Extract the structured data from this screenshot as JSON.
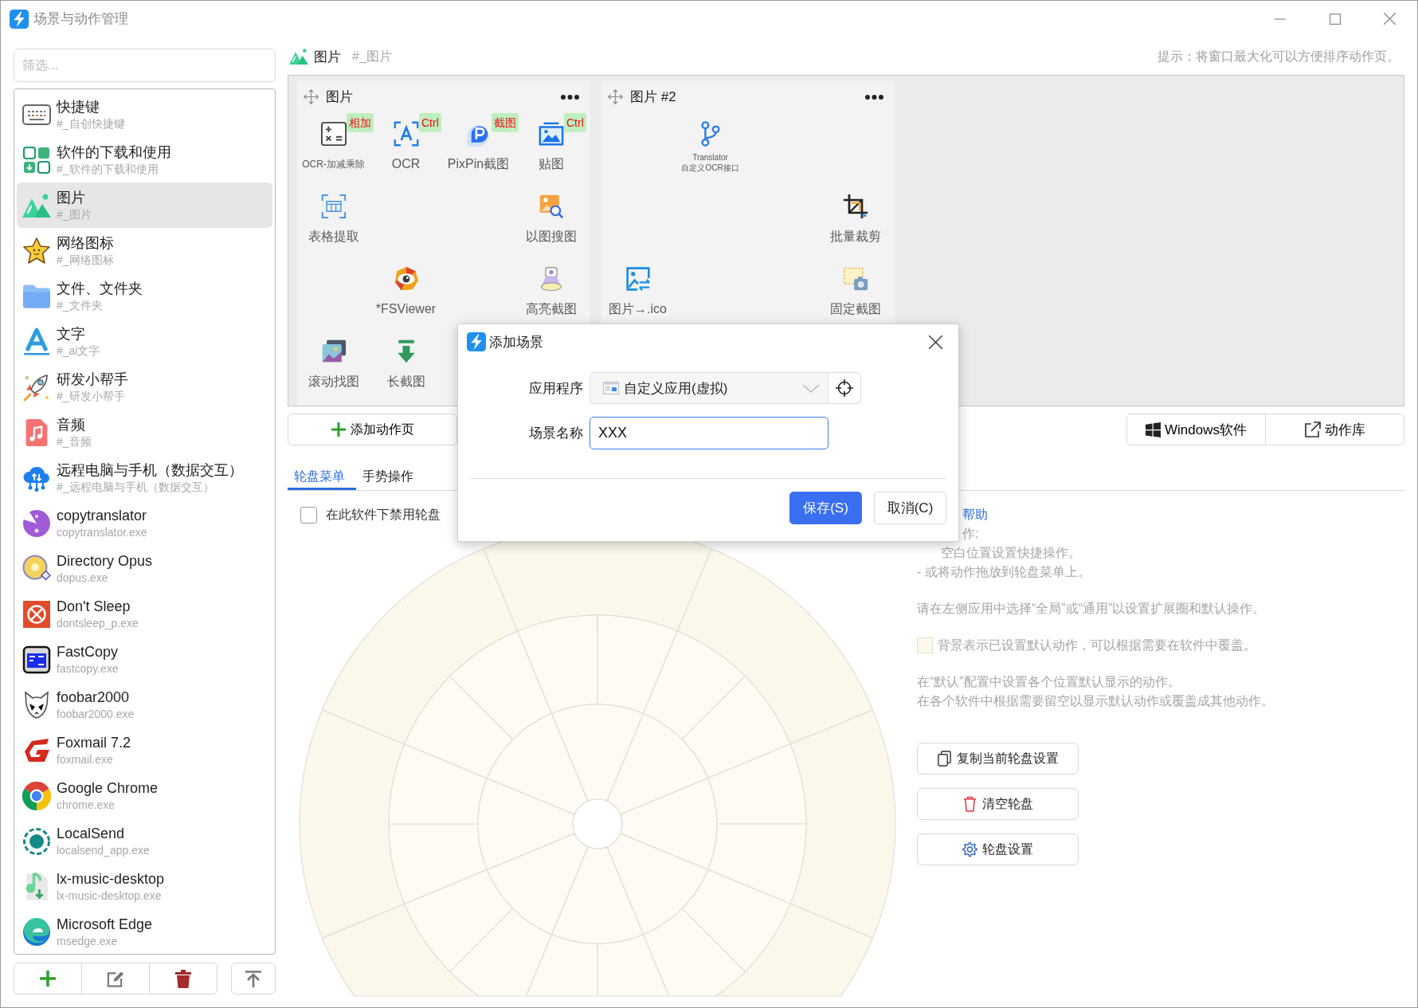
{
  "window": {
    "title": "场景与动作管理"
  },
  "sidebar": {
    "filter": {
      "placeholder": "筛选..."
    },
    "items": [
      {
        "name": "快捷键",
        "tag": "#_自创快捷键",
        "selected": false
      },
      {
        "name": "软件的下载和使用",
        "tag": "#_软件的下载和使用",
        "selected": false
      },
      {
        "name": "图片",
        "tag": "#_图片",
        "selected": true
      },
      {
        "name": "网络图标",
        "tag": "#_网络图标",
        "selected": false
      },
      {
        "name": "文件、文件夹",
        "tag": "#_文件夹",
        "selected": false
      },
      {
        "name": "文字",
        "tag": "#_ai文字",
        "selected": false
      },
      {
        "name": "研发小帮手",
        "tag": "#_研发小帮手",
        "selected": false
      },
      {
        "name": "音频",
        "tag": "#_音频",
        "selected": false
      },
      {
        "name": "远程电脑与手机（数据交互）",
        "tag": "#_远程电脑与手机（数据交互）",
        "selected": false
      },
      {
        "name": "copytranslator",
        "tag": "copytranslator.exe",
        "selected": false
      },
      {
        "name": "Directory Opus",
        "tag": "dopus.exe",
        "selected": false
      },
      {
        "name": "Don't Sleep",
        "tag": "dontsleep_p.exe",
        "selected": false
      },
      {
        "name": "FastCopy",
        "tag": "fastcopy.exe",
        "selected": false
      },
      {
        "name": "foobar2000",
        "tag": "foobar2000.exe",
        "selected": false
      },
      {
        "name": "Foxmail 7.2",
        "tag": "foxmail.exe",
        "selected": false
      },
      {
        "name": "Google Chrome",
        "tag": "chrome.exe",
        "selected": false
      },
      {
        "name": "LocalSend",
        "tag": "localsend_app.exe",
        "selected": false
      },
      {
        "name": "lx-music-desktop",
        "tag": "lx-music-desktop.exe",
        "selected": false
      },
      {
        "name": "Microsoft Edge",
        "tag": "msedge.exe",
        "selected": false
      }
    ]
  },
  "scene": {
    "title": "图片",
    "tag": "#_图片",
    "hint": "提示：将窗口最大化可以方便排序动作页。"
  },
  "action_pages": [
    {
      "title": "图片",
      "rows": [
        [
          {
            "kind": "action",
            "label": "OCR-加减乘除",
            "badge": "相加"
          },
          {
            "kind": "action",
            "label": "OCR",
            "badge": "Ctrl"
          },
          {
            "kind": "action",
            "label": "PixPin截图",
            "badge": "截图"
          },
          {
            "kind": "action",
            "label": "贴图",
            "badge": "Ctrl"
          }
        ],
        [
          {
            "kind": "action",
            "label": "表格提取"
          },
          {
            "kind": "empty"
          },
          {
            "kind": "empty"
          },
          {
            "kind": "action",
            "label": "以图搜图"
          }
        ],
        [
          {
            "kind": "empty"
          },
          {
            "kind": "action",
            "label": "*FSViewer"
          },
          {
            "kind": "empty"
          },
          {
            "kind": "action",
            "label": "高亮截图"
          }
        ],
        [
          {
            "kind": "action",
            "label": "滚动找图"
          },
          {
            "kind": "action",
            "label": "长截图"
          }
        ]
      ]
    },
    {
      "title": "图片 #2",
      "rows": [
        [
          {
            "kind": "empty"
          },
          {
            "kind": "compact",
            "lines": [
              "Translator",
              "自定义OCR接口"
            ]
          },
          {
            "kind": "empty"
          },
          {
            "kind": "empty"
          }
        ],
        [
          {
            "kind": "empty"
          },
          {
            "kind": "empty"
          },
          {
            "kind": "empty"
          },
          {
            "kind": "action",
            "label": "批量裁剪"
          }
        ],
        [
          {
            "kind": "action",
            "label": "图片→.ico"
          },
          {
            "kind": "empty"
          },
          {
            "kind": "empty"
          },
          {
            "kind": "action",
            "label": "固定截图"
          }
        ]
      ]
    }
  ],
  "add_page_button": {
    "label": "添加动作页"
  },
  "library_buttons": [
    {
      "label": "Windows软件"
    },
    {
      "label": "动作库"
    }
  ],
  "tabs": [
    {
      "label": "轮盘菜单",
      "selected": true
    },
    {
      "label": "手势操作",
      "selected": false
    }
  ],
  "disable_checkbox": {
    "label": "在此软件下禁用轮盘",
    "checked": false
  },
  "help": {
    "link": "帮助",
    "lines": [
      "作:",
      "空白位置设置快捷操作。",
      "- 或将动作拖放到轮盘菜单上。"
    ]
  },
  "notes": [
    {
      "kind": "text",
      "lines": [
        "请在左侧应用中选择“全局”或“通用”以设置扩展圈和默认操作。"
      ]
    },
    {
      "kind": "legend",
      "lines": [
        "背景表示已设置默认动作，可以根据需要在软件中覆盖。"
      ]
    },
    {
      "kind": "text",
      "lines": [
        "在“默认”配置中设置各个位置默认显示的动作。",
        "在各个软件中根据需要留空以显示默认动作或覆盖成其他动作。"
      ]
    }
  ],
  "wheel_buttons": [
    {
      "label": "复制当前轮盘设置"
    },
    {
      "label": "清空轮盘"
    },
    {
      "label": "轮盘设置"
    }
  ],
  "dialog": {
    "title": "添加场景",
    "fields": [
      {
        "kind": "select",
        "label": "应用程序",
        "value": "自定义应用(虚拟)"
      },
      {
        "kind": "text",
        "label": "场景名称",
        "value": "XXX",
        "focused": true
      }
    ],
    "buttons": [
      {
        "kind": "primary",
        "label": "保存(S)"
      },
      {
        "kind": "secondary",
        "label": "取消(C)"
      }
    ]
  }
}
